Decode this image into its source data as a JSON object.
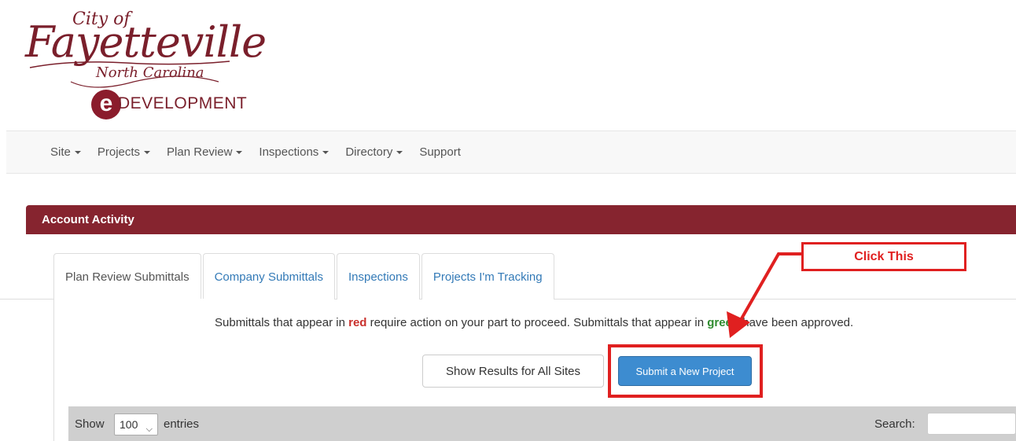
{
  "logo": {
    "city_of": "City of",
    "name": "Fayetteville",
    "state": "North Carolina",
    "e_letter": "e",
    "development": "DEVELOPMENT"
  },
  "nav": {
    "items": [
      {
        "label": "Site",
        "dropdown": true
      },
      {
        "label": "Projects",
        "dropdown": true
      },
      {
        "label": "Plan Review",
        "dropdown": true
      },
      {
        "label": "Inspections",
        "dropdown": true
      },
      {
        "label": "Directory",
        "dropdown": true
      },
      {
        "label": "Support",
        "dropdown": false
      }
    ]
  },
  "panel": {
    "title": "Account Activity"
  },
  "tabs": [
    {
      "label": "Plan Review Submittals",
      "active": true
    },
    {
      "label": "Company Submittals",
      "active": false
    },
    {
      "label": "Inspections",
      "active": false
    },
    {
      "label": "Projects I'm Tracking",
      "active": false
    }
  ],
  "info": {
    "part1": "Submittals that appear in ",
    "red_word": "red",
    "part2": " require action on your part to proceed. Submittals that appear in ",
    "green_word": "green",
    "part3": " have been approved."
  },
  "buttons": {
    "show_all": "Show Results for All Sites",
    "submit_new": "Submit a New Project"
  },
  "annotation": {
    "callout": "Click This"
  },
  "table_controls": {
    "show_label": "Show",
    "page_size": "100",
    "entries_label": "entries",
    "search_label": "Search:",
    "search_value": ""
  },
  "colors": {
    "brand": "#86242f",
    "primary": "#3d8cd0",
    "annotation_red": "#e02020",
    "link": "#337ab7"
  }
}
